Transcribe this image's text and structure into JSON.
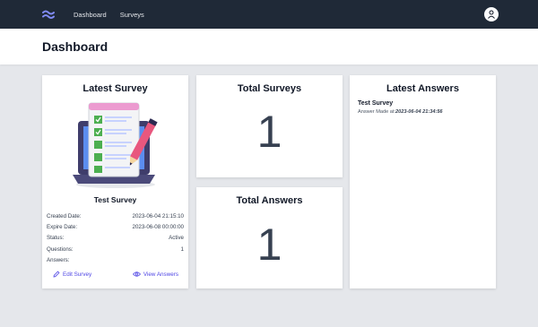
{
  "nav": {
    "links": [
      {
        "label": "Dashboard"
      },
      {
        "label": "Surveys"
      }
    ]
  },
  "page": {
    "title": "Dashboard"
  },
  "latest_survey": {
    "card_title": "Latest Survey",
    "name": "Test Survey",
    "details": [
      {
        "label": "Created Date:",
        "value": "2023-06-04 21:15:10"
      },
      {
        "label": "Expire Date:",
        "value": "2023-06-08 00:00:00"
      },
      {
        "label": "Status:",
        "value": "Active"
      },
      {
        "label": "Questions:",
        "value": "1"
      },
      {
        "label": "Answers:",
        "value": ""
      }
    ],
    "edit_label": "Edit Survey",
    "view_label": "View Answers"
  },
  "total_surveys": {
    "title": "Total Surveys",
    "value": "1"
  },
  "total_answers": {
    "title": "Total Answers",
    "value": "1"
  },
  "latest_answers": {
    "title": "Latest Answers",
    "items": [
      {
        "survey": "Test Survey",
        "prefix": "Answer Made at:",
        "date": "2023-06-04 21:34:56"
      }
    ]
  },
  "colors": {
    "navbar": "#1f2937",
    "accent": "#4f46e5",
    "background": "#e5e7eb"
  }
}
